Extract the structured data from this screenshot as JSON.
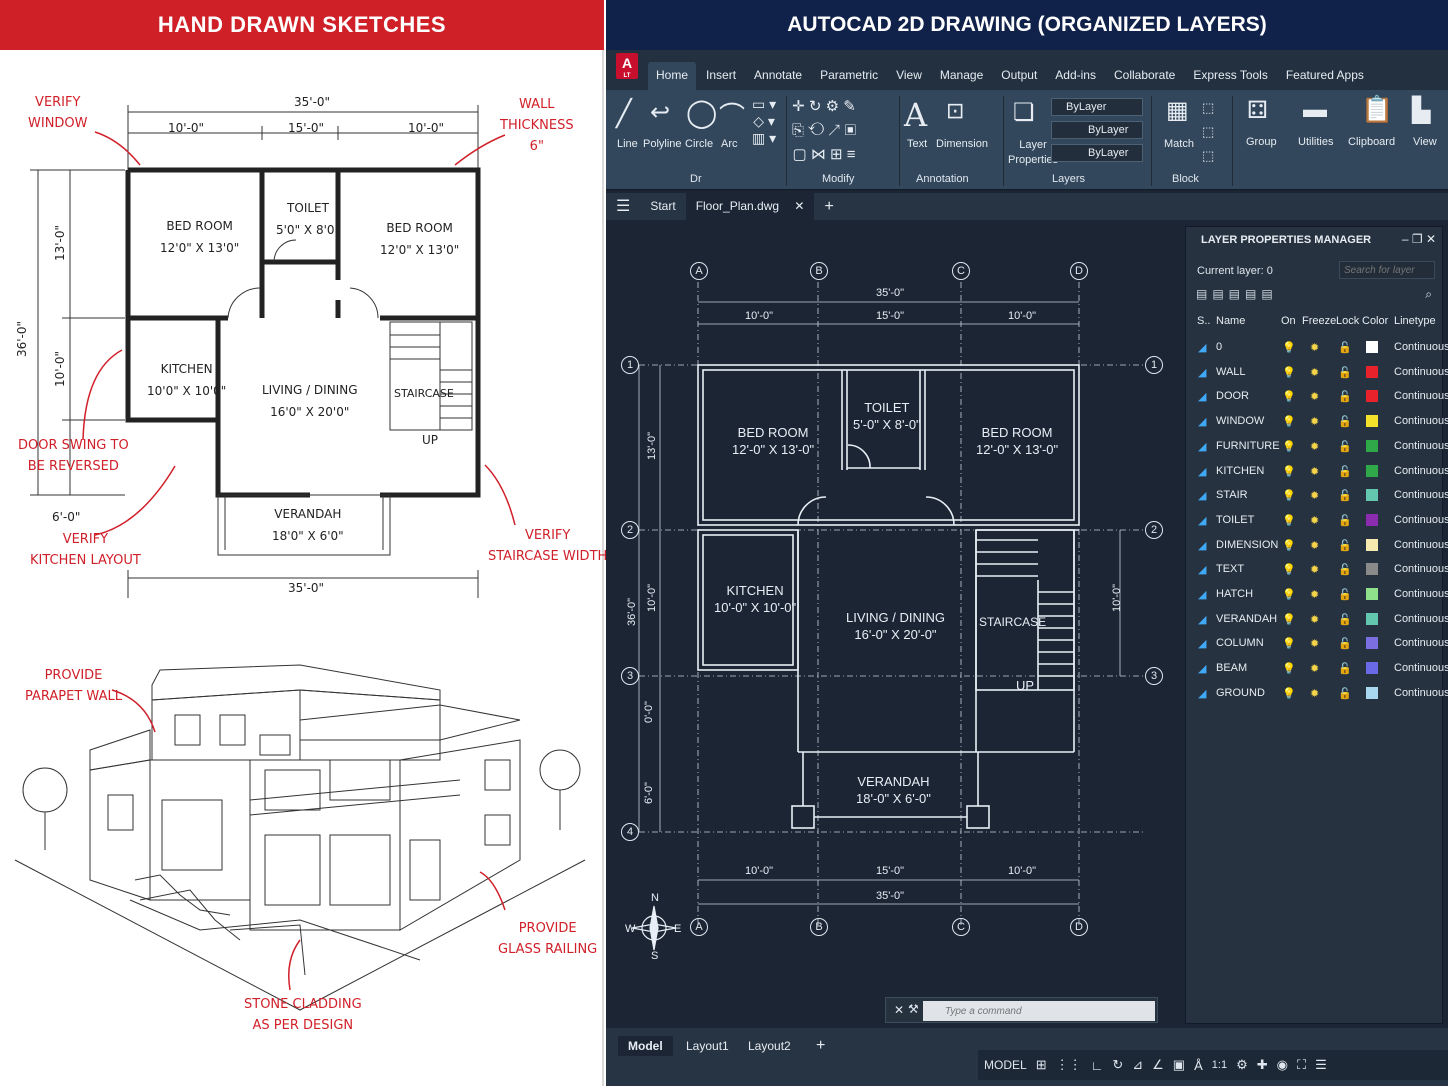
{
  "left": {
    "banner": "HAND DRAWN SKETCHES",
    "notes": {
      "verify_window": [
        "VERIFY",
        "WINDOW"
      ],
      "wall_thickness": [
        "WALL",
        "THICKNESS",
        "6\""
      ],
      "door_swing": [
        "DOOR SWING TO",
        "BE REVERSED"
      ],
      "verify_kitchen": [
        "VERIFY",
        "KITCHEN LAYOUT"
      ],
      "verify_staircase": [
        "VERIFY",
        "STAIRCASE WIDTH"
      ],
      "parapet": [
        "PROVIDE",
        "PARAPET WALL"
      ],
      "glass_railing": [
        "PROVIDE",
        "GLASS RAILING"
      ],
      "stone_cladding": [
        "STONE CLADDING",
        "AS PER DESIGN"
      ]
    },
    "rooms": {
      "bed1": [
        "BED ROOM",
        "12'0\" X 13'0\""
      ],
      "toilet": [
        "TOILET",
        "5'0\" X 8'0\""
      ],
      "bed2": [
        "BED ROOM",
        "12'0\" X 13'0\""
      ],
      "kitchen": [
        "KITCHEN",
        "10'0\" X 10'0\""
      ],
      "living": [
        "LIVING / DINING",
        "16'0\" X 20'0\""
      ],
      "staircase": "STAIRCASE",
      "up": "UP",
      "verandah": [
        "VERANDAH",
        "18'0\" X 6'0\""
      ]
    },
    "dims": {
      "top_total": "35'-0\"",
      "top_a": "10'-0\"",
      "top_b": "15'-0\"",
      "top_c": "10'-0\"",
      "left_total": "36'-0\"",
      "left_a": "13'-0\"",
      "left_b": "10'-0\"",
      "left_c": "6'-0\"",
      "bottom_total": "35'-0\""
    }
  },
  "right": {
    "banner": "AUTOCAD 2D DRAWING (ORGANIZED LAYERS)",
    "logo": "A",
    "logo_sub": "LT",
    "tabs": [
      "Home",
      "Insert",
      "Annotate",
      "Parametric",
      "View",
      "Manage",
      "Output",
      "Add-ins",
      "Collaborate",
      "Express Tools",
      "Featured Apps"
    ],
    "draw_buttons": [
      "Line",
      "Polyline",
      "Circle",
      "Arc"
    ],
    "text_btn": "Text",
    "dimension_btn": "Dimension",
    "layer_props_btn": [
      "Layer",
      "Properties"
    ],
    "bylayer": [
      "ByLayer",
      "ByLayer",
      "ByLayer"
    ],
    "match_btn": "Match",
    "group_btn": "Group",
    "utilities_btn": "Utilities",
    "clipboard_btn": "Clipboard",
    "view_btn": "View",
    "panels": [
      "Dr",
      "Modify",
      "Annotation",
      "Layers",
      "Block"
    ],
    "doc_tabs": [
      "Start",
      "Floor_Plan.dwg"
    ],
    "add_tab": "+",
    "cad": {
      "cols": [
        "A",
        "B",
        "C",
        "D"
      ],
      "rows": [
        "1",
        "2",
        "3",
        "4"
      ],
      "dims_top": [
        "35'-0\"",
        "10'-0\"",
        "15'-0\"",
        "10'-0\""
      ],
      "dims_bottom": [
        "10'-0\"",
        "15'-0\"",
        "10'-0\"",
        "35'-0\""
      ],
      "dims_left": [
        "13'-0\"",
        "10'-0\"",
        "0'-0\"",
        "6'-0\"",
        "36'-0\""
      ],
      "dim_right": "10'-0\"",
      "rooms": {
        "bed1": [
          "BED ROOM",
          "12'-0\" X 13'-0\""
        ],
        "toilet": [
          "TOILET",
          "5'-0\" X 8'-0\""
        ],
        "bed2": [
          "BED ROOM",
          "12'-0\" X 13'-0\""
        ],
        "kitchen": [
          "KITCHEN",
          "10'-0\" X 10'-0\""
        ],
        "living": [
          "LIVING / DINING",
          "16'-0\" X 20'-0\""
        ],
        "staircase": "STAIRCASE",
        "up": "UP",
        "verandah": [
          "VERANDAH",
          "18'-0\" X 6'-0\""
        ]
      },
      "compass": {
        "n": "N",
        "s": "S",
        "e": "E",
        "w": "W"
      }
    },
    "lpm": {
      "title": "LAYER PROPERTIES MANAGER",
      "current": "Current layer: 0",
      "search_placeholder": "Search for layer",
      "headers": [
        "S..",
        "Name",
        "On",
        "Freeze",
        "Lock",
        "Color",
        "Linetype"
      ],
      "layers": [
        {
          "name": "0",
          "color": "#ffffff",
          "linetype": "Continuous"
        },
        {
          "name": "WALL",
          "color": "#e8222b",
          "linetype": "Continuous"
        },
        {
          "name": "DOOR",
          "color": "#e8222b",
          "linetype": "Continuous"
        },
        {
          "name": "WINDOW",
          "color": "#f2e02a",
          "linetype": "Continuous"
        },
        {
          "name": "FURNITURE",
          "color": "#2fa84a",
          "linetype": "Continuous"
        },
        {
          "name": "KITCHEN",
          "color": "#2fa84a",
          "linetype": "Continuous"
        },
        {
          "name": "STAIR",
          "color": "#63c7b0",
          "linetype": "Continuous"
        },
        {
          "name": "TOILET",
          "color": "#8a2bb0",
          "linetype": "Continuous"
        },
        {
          "name": "DIMENSION",
          "color": "#f6e9b0",
          "linetype": "Continuous"
        },
        {
          "name": "TEXT",
          "color": "#8a8a8a",
          "linetype": "Continuous"
        },
        {
          "name": "HATCH",
          "color": "#8fe08a",
          "linetype": "Continuous"
        },
        {
          "name": "VERANDAH",
          "color": "#63c7b0",
          "linetype": "Continuous"
        },
        {
          "name": "COLUMN",
          "color": "#7b6ee0",
          "linetype": "Continuous"
        },
        {
          "name": "BEAM",
          "color": "#6a6ae8",
          "linetype": "Continuous"
        },
        {
          "name": "GROUND",
          "color": "#a8d8f0",
          "linetype": "Continuous"
        }
      ]
    },
    "command_placeholder": "Type a command",
    "bottom_tabs": [
      "Model",
      "Layout1",
      "Layout2"
    ],
    "status": {
      "model": "MODEL",
      "scale": "1:1"
    }
  }
}
